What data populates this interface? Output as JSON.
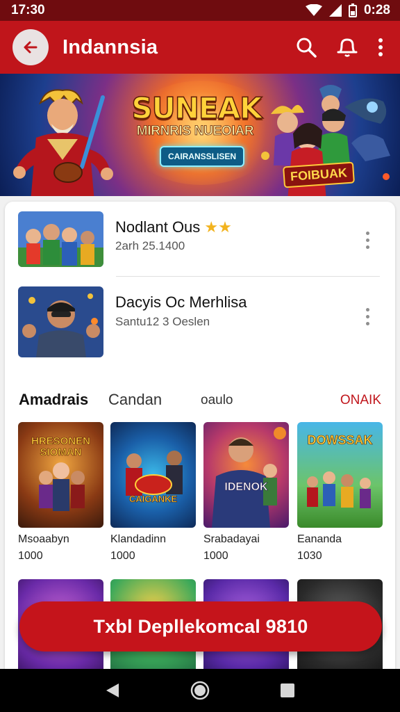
{
  "status_bar": {
    "time": "17:30",
    "battery_time": "0:28"
  },
  "app_bar": {
    "title": "Indannsia"
  },
  "banner": {
    "title": "SUNEAK",
    "subtitle": "MIRNRIS NUEOIAR",
    "pill": "CAIRANSSLISEN",
    "tag": "FOIBUAK"
  },
  "list": [
    {
      "title": "Nodlant Ous",
      "subtitle": "2arh 25.1400"
    },
    {
      "title": "Dacyis Oc Merhlisa",
      "subtitle": "Santu12 3 Oeslen"
    }
  ],
  "tabs": {
    "active": "Amadrais",
    "second": "Candan",
    "third": "oaulo",
    "more": "ONAIK"
  },
  "grid": [
    {
      "name": "Msoaabyn",
      "count": "1000",
      "art": "HRESONEN SIOMAN"
    },
    {
      "name": "Klandadinn",
      "count": "1000",
      "art": "CAIGANKE"
    },
    {
      "name": "Srabadayai",
      "count": "1000",
      "art": "IDENOK"
    },
    {
      "name": "Eananda",
      "count": "1030",
      "art": "DOWSSAK"
    }
  ],
  "fab": {
    "label": "Txbl Depllekomcal 9810"
  },
  "colors": {
    "primary": "#c0151b",
    "status_bar": "#6f0c0f"
  }
}
